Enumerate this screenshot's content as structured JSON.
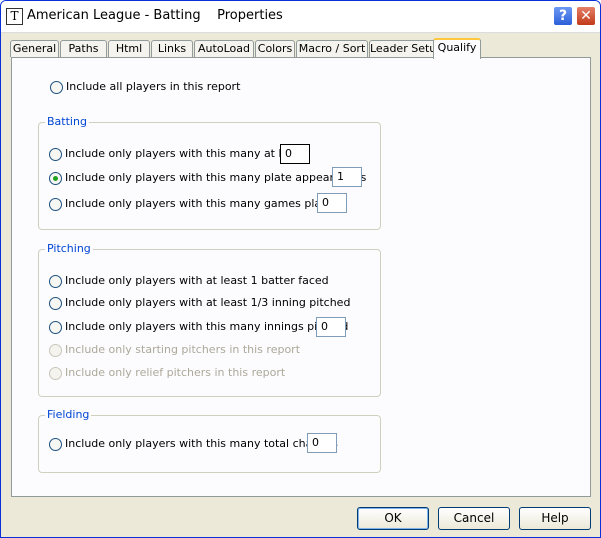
{
  "window": {
    "icon_glyph": "T",
    "title": "American League - Batting    Properties",
    "help_glyph": "?",
    "close_glyph": "✕"
  },
  "tabs": [
    "General",
    "Paths",
    "Html",
    "Links",
    "AutoLoad",
    "Colors",
    "Macro / Sort",
    "Leader Setup",
    "Qualify"
  ],
  "active_tab": "Qualify",
  "options": {
    "all_players": "Include all players in this report"
  },
  "batting": {
    "label": "Batting",
    "at_bats_label": "Include only players with this many at bats",
    "at_bats_value": "0",
    "plate_appearances_label": "Include only players with this many plate appearances",
    "plate_appearances_value": "1",
    "games_played_label": "Include only players with this many games played",
    "games_played_value": "0"
  },
  "pitching": {
    "label": "Pitching",
    "batter_faced_label": "Include only players with at least 1 batter faced",
    "inning_pitched_label": "Include only players with at least 1/3 inning pitched",
    "innings_pitched_label": "Include only players with this many innings pitched",
    "innings_pitched_value": "0",
    "starting_pitchers_label": "Include only starting pitchers in this report",
    "relief_pitchers_label": "Include only relief pitchers in this report"
  },
  "fielding": {
    "label": "Fielding",
    "total_chances_label": "Include only players with this many total chances",
    "total_chances_value": "0"
  },
  "selected_option": "plate_appearances",
  "buttons": {
    "ok": "OK",
    "cancel": "Cancel",
    "help": "Help"
  }
}
